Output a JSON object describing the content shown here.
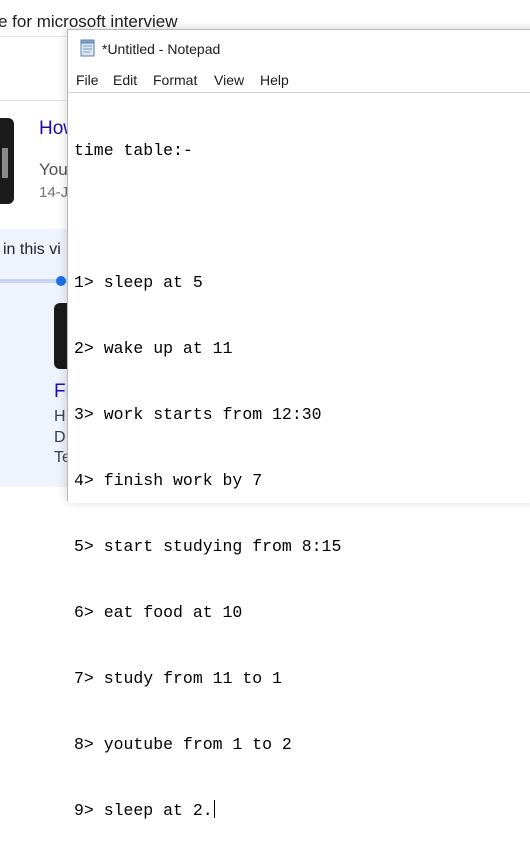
{
  "background": {
    "search_text": "e for microsoft interview",
    "result_link": "How",
    "result_snippet": "You",
    "result_date": "14-J",
    "in_this_video": "in this vi",
    "result2_title": "Fr",
    "result2_line1": "H",
    "result2_line2": "D",
    "result2_line3": "Te"
  },
  "notepad": {
    "title": "*Untitled - Notepad",
    "menu": [
      "File",
      "Edit",
      "Format",
      "View",
      "Help"
    ],
    "lines": [
      "time table:-",
      "",
      "1> sleep at 5",
      "2> wake up at 11",
      "3> work starts from 12:30",
      "4> finish work by 7",
      "5> start studying from 8:15",
      "6> eat food at 10",
      "7> study from 11 to 1",
      "8> youtube from 1 to 2",
      "9> sleep at 2."
    ],
    "icon": "notepad-icon"
  },
  "colors": {
    "link": "#1a0dab",
    "accent_blue": "#1a73e8",
    "panel_bg": "#eef3fd"
  }
}
